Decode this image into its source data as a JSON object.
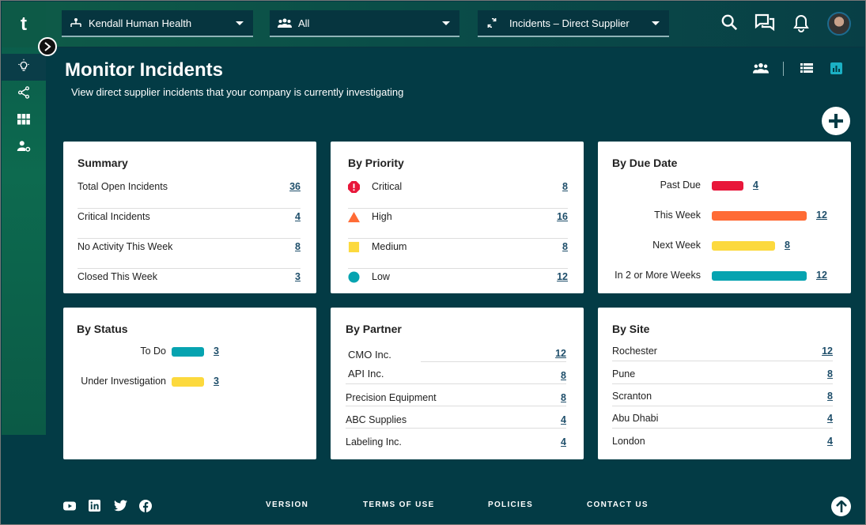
{
  "app": {
    "logo": "t"
  },
  "topbar": {
    "company": "Kendall Human Health",
    "group": "All",
    "view": "Incidents – Direct Supplier"
  },
  "header": {
    "title": "Monitor Incidents",
    "subtitle": "View direct supplier incidents that your company is currently investigating"
  },
  "summary": {
    "title": "Summary",
    "rows": [
      {
        "label": "Total Open Incidents",
        "value": "36"
      },
      {
        "label": "Critical Incidents",
        "value": "4"
      },
      {
        "label": "No Activity This Week",
        "value": "8"
      },
      {
        "label": "Closed This Week",
        "value": "3"
      }
    ]
  },
  "priority": {
    "title": "By Priority",
    "rows": [
      {
        "label": "Critical",
        "value": "8",
        "color": "#e8173a",
        "icon": "critical-octagon-icon"
      },
      {
        "label": "High",
        "value": "16",
        "color": "#ff6b35",
        "icon": "high-triangle-icon"
      },
      {
        "label": "Medium",
        "value": "8",
        "color": "#fcd93d",
        "icon": "medium-square-icon"
      },
      {
        "label": "Low",
        "value": "12",
        "color": "#06a3b0",
        "icon": "low-circle-icon"
      }
    ]
  },
  "due_date": {
    "title": "By Due Date",
    "rows": [
      {
        "label": "Past Due",
        "value": 4,
        "color": "#e8173a"
      },
      {
        "label": "This Week",
        "value": 12,
        "color": "#ff6b35"
      },
      {
        "label": "Next Week",
        "value": 8,
        "color": "#fcd93d"
      },
      {
        "label": "In 2 or More Weeks",
        "value": 12,
        "color": "#06a3b0"
      }
    ]
  },
  "status": {
    "title": "By Status",
    "rows": [
      {
        "label": "To Do",
        "value": 3,
        "color": "#06a3b0"
      },
      {
        "label": "Under Investigation",
        "value": 3,
        "color": "#fcd93d"
      }
    ]
  },
  "partner": {
    "title": "By Partner",
    "rows": [
      {
        "label": "CMO Inc.",
        "value": "12"
      },
      {
        "label": "API Inc.",
        "value": "8"
      },
      {
        "label": "Precision Equipment",
        "value": "8"
      },
      {
        "label": "ABC Supplies",
        "value": "4"
      },
      {
        "label": "Labeling Inc.",
        "value": "4"
      }
    ]
  },
  "site": {
    "title": "By Site",
    "rows": [
      {
        "label": "Rochester",
        "value": "12"
      },
      {
        "label": "Pune",
        "value": "8"
      },
      {
        "label": "Scranton",
        "value": "8"
      },
      {
        "label": "Abu Dhabi",
        "value": "4"
      },
      {
        "label": "London",
        "value": "4"
      }
    ]
  },
  "footer": {
    "links": [
      "VERSION",
      "TERMS OF USE",
      "POLICIES",
      "CONTACT US"
    ],
    "social_icons": [
      "youtube-icon",
      "linkedin-icon",
      "twitter-icon",
      "facebook-icon"
    ]
  }
}
